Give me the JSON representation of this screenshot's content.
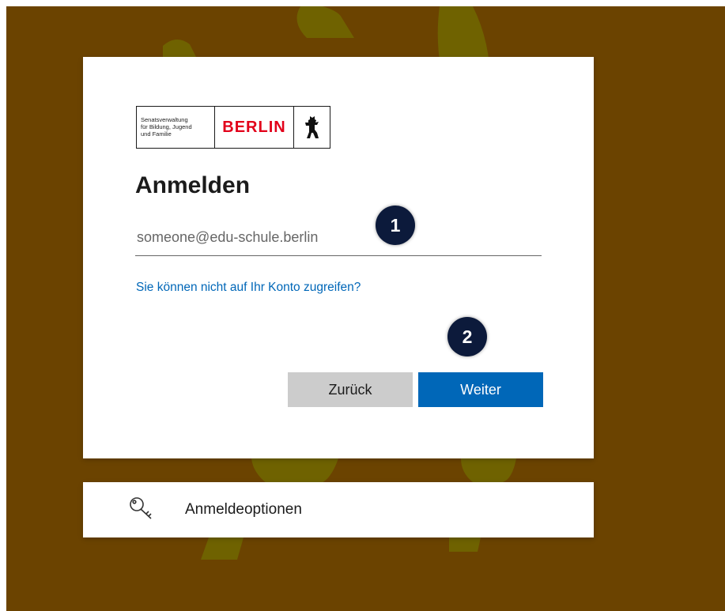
{
  "background": {
    "color": "#6b4300",
    "bear_color": "#6f6200"
  },
  "logo": {
    "org_lines": [
      "Senatsverwaltung",
      "für Bildung, Jugend",
      "und Familie"
    ],
    "city": "BERLIN",
    "city_color": "#e2001a",
    "emblem_icon": "berlin-bear-icon"
  },
  "signin": {
    "title": "Anmelden",
    "email_placeholder": "someone@edu-schule.berlin",
    "email_value": "",
    "cant_access_link": "Sie können nicht auf Ihr Konto zugreifen?",
    "back_label": "Zurück",
    "next_label": "Weiter",
    "accent_color": "#0067b8"
  },
  "annotations": {
    "step1": "1",
    "step2": "2"
  },
  "options": {
    "label": "Anmeldeoptionen",
    "icon": "key-icon"
  }
}
